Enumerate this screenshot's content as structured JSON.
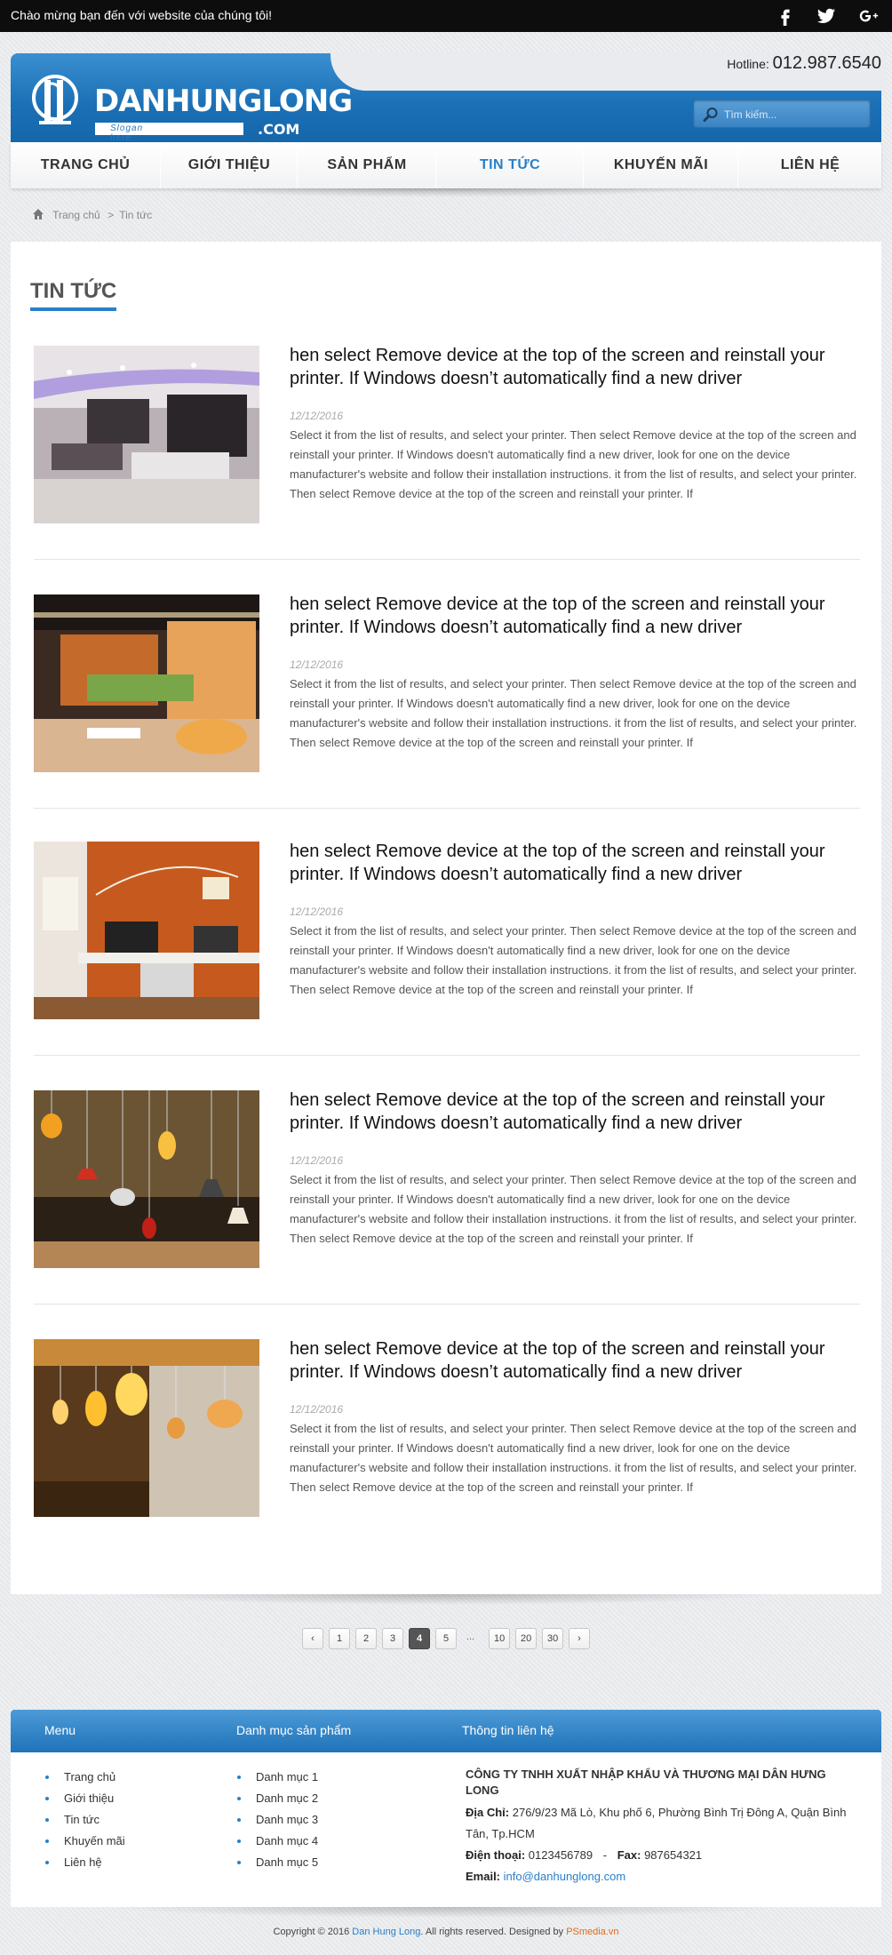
{
  "topbar": {
    "welcome": "Chào mừng bạn đến với website của chúng tôi!",
    "social": [
      {
        "icon": "facebook-icon"
      },
      {
        "icon": "twitter-icon"
      },
      {
        "icon": "google-plus-icon"
      }
    ]
  },
  "header": {
    "logo_text": "DANHUNGLONG",
    "slogan": "Slogan here",
    "logo_suffix": ".COM",
    "hotline_label": "Hotline:",
    "hotline_number": "012.987.6540",
    "search_placeholder": "Tìm kiếm..."
  },
  "nav": {
    "items": [
      {
        "label": "TRANG CHỦ",
        "active": false
      },
      {
        "label": "GIỚI THIỆU",
        "active": false
      },
      {
        "label": "SẢN PHẨM",
        "active": false
      },
      {
        "label": "TIN TỨC",
        "active": true
      },
      {
        "label": "KHUYẾN MÃI",
        "active": false
      },
      {
        "label": "LIÊN HỆ",
        "active": false
      }
    ]
  },
  "breadcrumb": {
    "home": "Trang chủ",
    "separator": ">",
    "current": "Tin tức"
  },
  "main": {
    "section_title": "TIN TỨC",
    "articles": [
      {
        "title": "hen select Remove device at the top of the screen and reinstall your printer. If Windows doesn’t automatically find a new driver",
        "date": "12/12/2016",
        "excerpt": "Select it from the list of results, and select your printer. Then select Remove device at the top of the screen and reinstall your printer. If Windows doesn't automatically find a new driver, look for one on the device manufacturer's website and follow their installation instructions.  it from the list of results, and select your printer. Then select Remove device at the top of the screen and reinstall your printer. If",
        "image": "interior-kitchen-photo"
      },
      {
        "title": "hen select Remove device at the top of the screen and reinstall your printer. If Windows doesn’t automatically find a new driver",
        "date": "12/12/2016",
        "excerpt": "Select it from the list of results, and select your printer. Then select Remove device at the top of the screen and reinstall your printer. If Windows doesn't automatically find a new driver, look for one on the device manufacturer's website and follow their installation instructions.  it from the list of results, and select your printer. Then select Remove device at the top of the screen and reinstall your printer. If",
        "image": "lounge-interior-photo"
      },
      {
        "title": "hen select Remove device at the top of the screen and reinstall your printer. If Windows doesn’t automatically find a new driver",
        "date": "12/12/2016",
        "excerpt": "Select it from the list of results, and select your printer. Then select Remove device at the top of the screen and reinstall your printer. If Windows doesn't automatically find a new driver, look for one on the device manufacturer's website and follow their installation instructions.  it from the list of results, and select your printer. Then select Remove device at the top of the screen and reinstall your printer. If",
        "image": "office-interior-photo"
      },
      {
        "title": "hen select Remove device at the top of the screen and reinstall your printer. If Windows doesn’t automatically find a new driver",
        "date": "12/12/2016",
        "excerpt": "Select it from the list of results, and select your printer. Then select Remove device at the top of the screen and reinstall your printer. If Windows doesn't automatically find a new driver, look for one on the device manufacturer's website and follow their installation instructions.  it from the list of results, and select your printer. Then select Remove device at the top of the screen and reinstall your printer. If",
        "image": "pendant-lamps-photo"
      },
      {
        "title": "hen select Remove device at the top of the screen and reinstall your printer. If Windows doesn’t automatically find a new driver",
        "date": "12/12/2016",
        "excerpt": "Select it from the list of results, and select your printer. Then select Remove device at the top of the screen and reinstall your printer. If Windows doesn't automatically find a new driver, look for one on the device manufacturer's website and follow their installation instructions.  it from the list of results, and select your printer. Then select Remove device at the top of the screen and reinstall your printer. If",
        "image": "hanging-lights-photo"
      }
    ]
  },
  "pagination": {
    "prev": "‹",
    "pages": [
      "1",
      "2",
      "3",
      "4",
      "5"
    ],
    "active": "4",
    "ellipsis": "...",
    "more_pages": [
      "10",
      "20",
      "30"
    ],
    "next": "›"
  },
  "footer": {
    "menu_heading": "Menu",
    "menu_items": [
      "Trang chủ",
      "Giới thiệu",
      "Tin tức",
      "Khuyến mãi",
      "Liên hệ"
    ],
    "categories_heading": "Danh mục sản phẩm",
    "categories": [
      "Danh mục 1",
      "Danh mục 2",
      "Danh mục 3",
      "Danh mục 4",
      "Danh mục 5"
    ],
    "contact_heading": "Thông tin liên hệ",
    "company": "CÔNG TY TNHH XUẤT NHẬP KHẨU VÀ THƯƠNG MẠI DÂN HƯNG LONG",
    "address_label": "Địa Chỉ:",
    "address": "276/9/23 Mã Lò, Khu phố 6, Phường Bình Trị Đông A, Quận Bình Tân, Tp.HCM",
    "phone_label": "Điện thoại:",
    "phone": "0123456789",
    "fax_sep": "-",
    "fax_label": "Fax:",
    "fax": "987654321",
    "email_label": "Email:",
    "email": "info@danhunglong.com"
  },
  "copyright": {
    "prefix": "Copyright © 2016",
    "company": "Dan Hung Long",
    "middle": ". All rights reserved. Designed by",
    "designer": "PSmedia.vn"
  },
  "colors": {
    "brand_blue": "#2a7fc8",
    "topbar_bg": "#0d0d0d",
    "designer_orange": "#e26b1b"
  }
}
